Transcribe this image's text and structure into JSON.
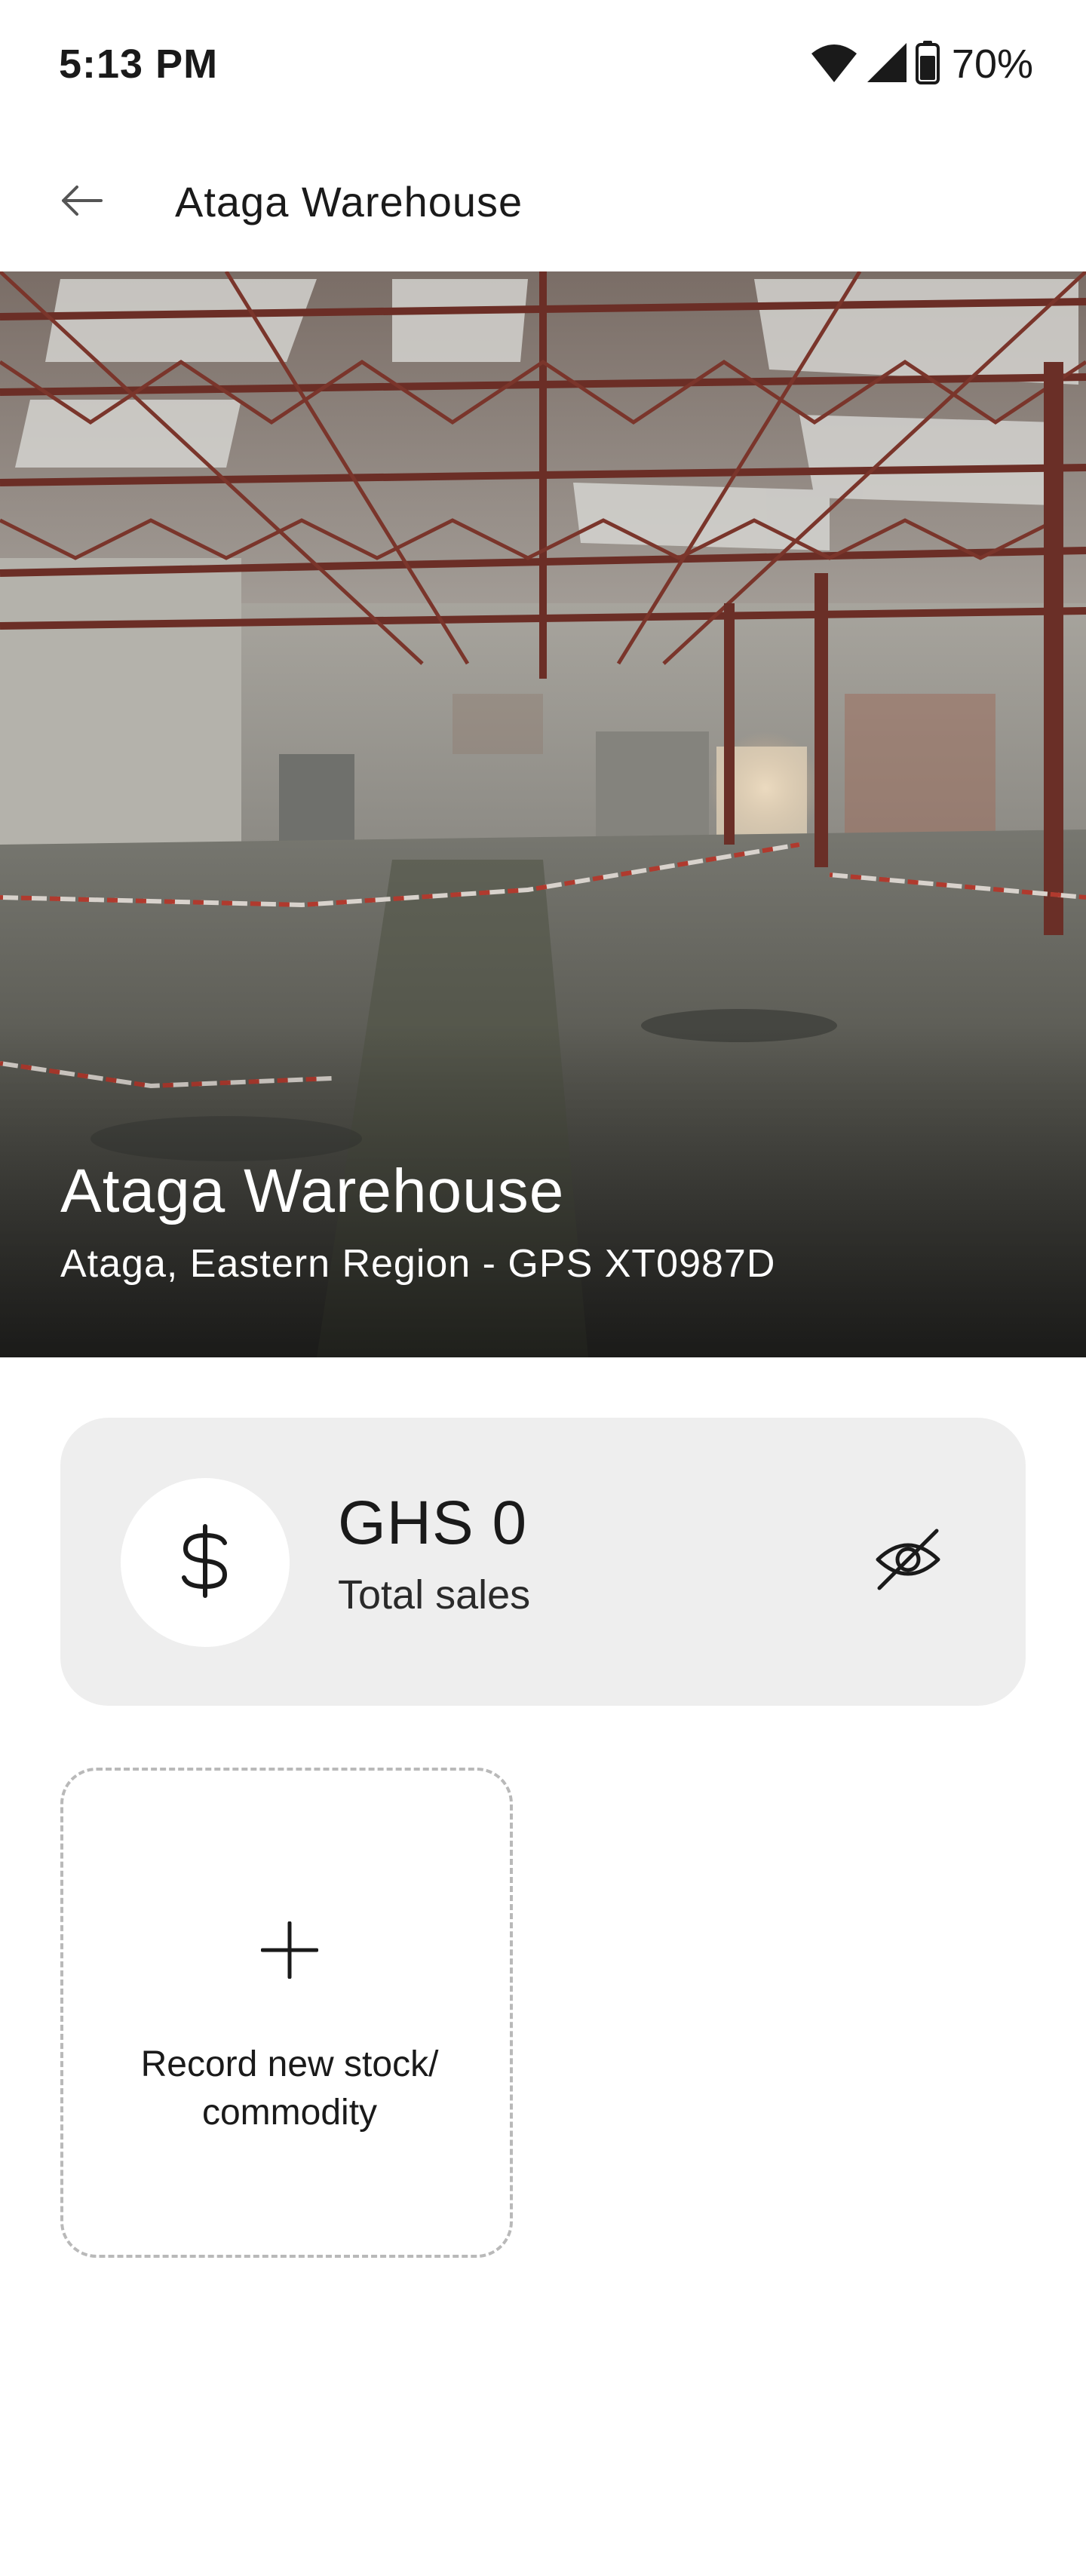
{
  "status_bar": {
    "time": "5:13 PM",
    "battery": "70%",
    "icons": [
      "wifi-icon",
      "signal-icon",
      "battery-icon"
    ]
  },
  "app_bar": {
    "back_icon": "arrow-left-icon",
    "title": "Ataga Warehouse"
  },
  "hero": {
    "image": "warehouse-interior-photo",
    "title": "Ataga Warehouse",
    "subtitle": "Ataga, Eastern Region - GPS XT0987D"
  },
  "sales_card": {
    "icon": "dollar-icon",
    "amount": "GHS 0",
    "label": "Total sales",
    "toggle_icon": "eye-off-icon"
  },
  "add_stock": {
    "icon": "plus-icon",
    "label": "Record new stock/ commodity"
  },
  "colors": {
    "card_background": "#eeeeee",
    "tile_border": "#b9b9b9",
    "text": "#1a1a1a",
    "hero_text": "#ffffff"
  }
}
